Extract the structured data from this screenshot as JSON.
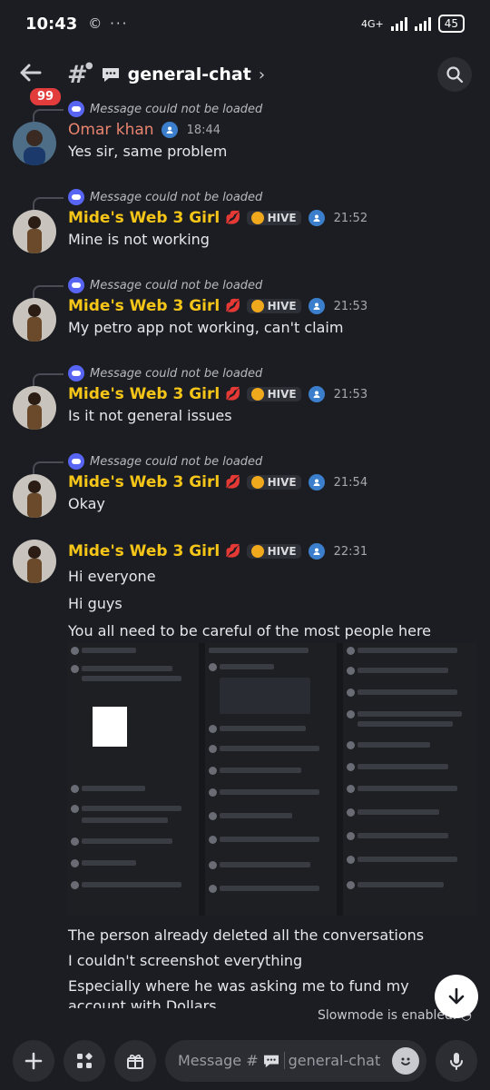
{
  "status_bar": {
    "time": "10:43",
    "network": "4G+",
    "battery": "45"
  },
  "header": {
    "unread_badge": "99",
    "channel": "general-chat"
  },
  "reply_text": "Message could not be loaded",
  "messages": [
    {
      "author": "Omar khan",
      "time": "18:44",
      "lines": [
        "Yes sir, same problem"
      ]
    },
    {
      "author": "Mide's Web 3 Girl",
      "tag": "HIVE",
      "time": "21:52",
      "lines": [
        "Mine is not working"
      ]
    },
    {
      "author": "Mide's Web 3 Girl",
      "tag": "HIVE",
      "time": "21:53",
      "lines": [
        "My petro app not working, can't claim"
      ]
    },
    {
      "author": "Mide's Web 3 Girl",
      "tag": "HIVE",
      "time": "21:53",
      "lines": [
        "Is it not general issues"
      ]
    },
    {
      "author": "Mide's Web 3 Girl",
      "tag": "HIVE",
      "time": "21:54",
      "lines": [
        "Okay"
      ]
    },
    {
      "author": "Mide's Web 3 Girl",
      "tag": "HIVE",
      "time": "22:31",
      "lines": [
        "Hi everyone",
        "Hi guys",
        "You all need to be careful of the most people here"
      ],
      "after": [
        "The person already deleted all the conversations",
        "I couldn't screenshot everything",
        "Especially where he was asking me to fund my account with Dollars"
      ]
    }
  ],
  "slowmode": "Slowmode is enabled.",
  "input": {
    "placeholder_prefix": "Message #",
    "placeholder_channel": "general-chat"
  }
}
